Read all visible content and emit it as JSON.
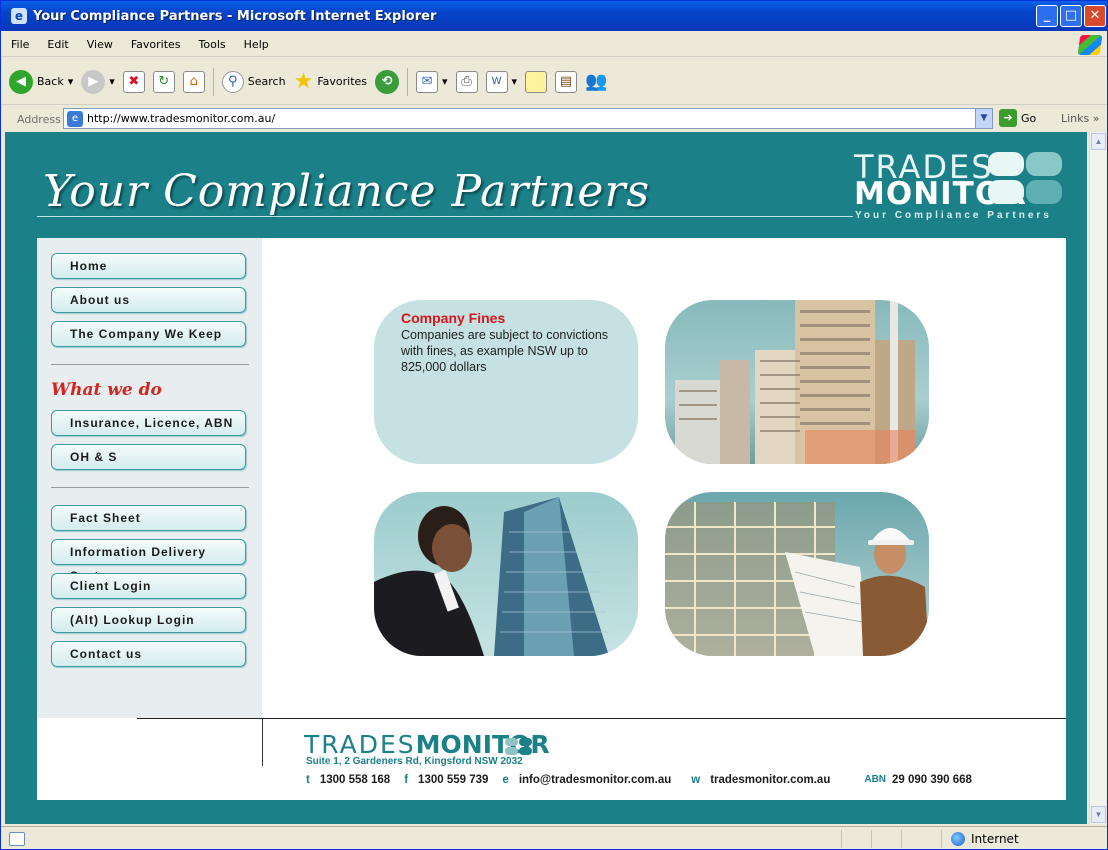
{
  "window": {
    "title": "Your Compliance Partners - Microsoft Internet Explorer"
  },
  "menu": [
    "File",
    "Edit",
    "View",
    "Favorites",
    "Tools",
    "Help"
  ],
  "toolbar": {
    "back": "Back",
    "search": "Search",
    "favorites": "Favorites"
  },
  "address": {
    "label": "Address",
    "url": "http://www.tradesmonitor.com.au/",
    "go": "Go",
    "links": "Links"
  },
  "header": {
    "title": "Your Compliance Partners",
    "logo_top": "TRADES",
    "logo_bottom": "MONITOR",
    "logo_tagline": "Your Compliance Partners"
  },
  "nav": {
    "top": [
      "Home",
      "About us",
      "The Company We Keep"
    ],
    "section_heading": "What we do",
    "services": [
      "Insurance, Licence, ABN",
      "OH & S"
    ],
    "bottom": [
      "Fact Sheet",
      "Information Delivery System",
      "Client Login",
      "(Alt) Lookup Login",
      "Contact us"
    ]
  },
  "tile": {
    "heading": "Company Fines",
    "body": "Companies are subject to convictions with fines, as example NSW up to 825,000 dollars"
  },
  "footer": {
    "brand_light": "TRADES",
    "brand_bold": "MONITOR",
    "address": "Suite 1, 2 Gardeners Rd, Kingsford NSW 2032",
    "contacts": [
      {
        "key": "t",
        "value": "1300 558 168"
      },
      {
        "key": "f",
        "value": "1300 559 739"
      },
      {
        "key": "e",
        "value": "info@tradesmonitor.com.au"
      },
      {
        "key": "w",
        "value": "tradesmonitor.com.au"
      },
      {
        "key": "ABN",
        "value": "29 090 390 668"
      }
    ]
  },
  "status": {
    "zone": "Internet"
  },
  "colors": {
    "teal": "#1b8088",
    "accent_red": "#d4261f",
    "tile_bg": "#c5e1e1"
  }
}
